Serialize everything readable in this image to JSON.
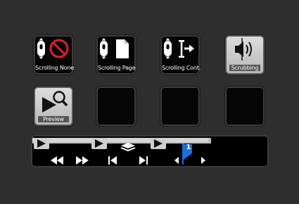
{
  "grid": {
    "row1": [
      {
        "label": "Scrolling None",
        "icon": "mouse-no-scroll-icon"
      },
      {
        "label": "Scrolling Page",
        "icon": "mouse-page-icon"
      },
      {
        "label": "Scrolling Cont.",
        "icon": "mouse-continuous-icon"
      },
      {
        "label": "Scrubbing",
        "icon": "speaker-scrub-icon"
      }
    ],
    "row2": [
      {
        "label": "Preview",
        "icon": "play-magnifier-icon"
      },
      {
        "label": "",
        "icon": ""
      },
      {
        "label": "",
        "icon": ""
      },
      {
        "label": "",
        "icon": ""
      }
    ]
  },
  "transport": {
    "controls": [
      "rewind-icon",
      "fast-forward-icon",
      "go-to-start-icon",
      "go-to-end-icon",
      "previous-marker-icon",
      "marker-flag-icon",
      "next-marker-icon"
    ],
    "marker_number": "1"
  },
  "colors": {
    "background": "#2e2e2e",
    "button_dark": "#050505",
    "button_light": "#c8c8c8",
    "marker_blue": "#1a6fe0",
    "no_symbol_red": "#e0202a"
  }
}
